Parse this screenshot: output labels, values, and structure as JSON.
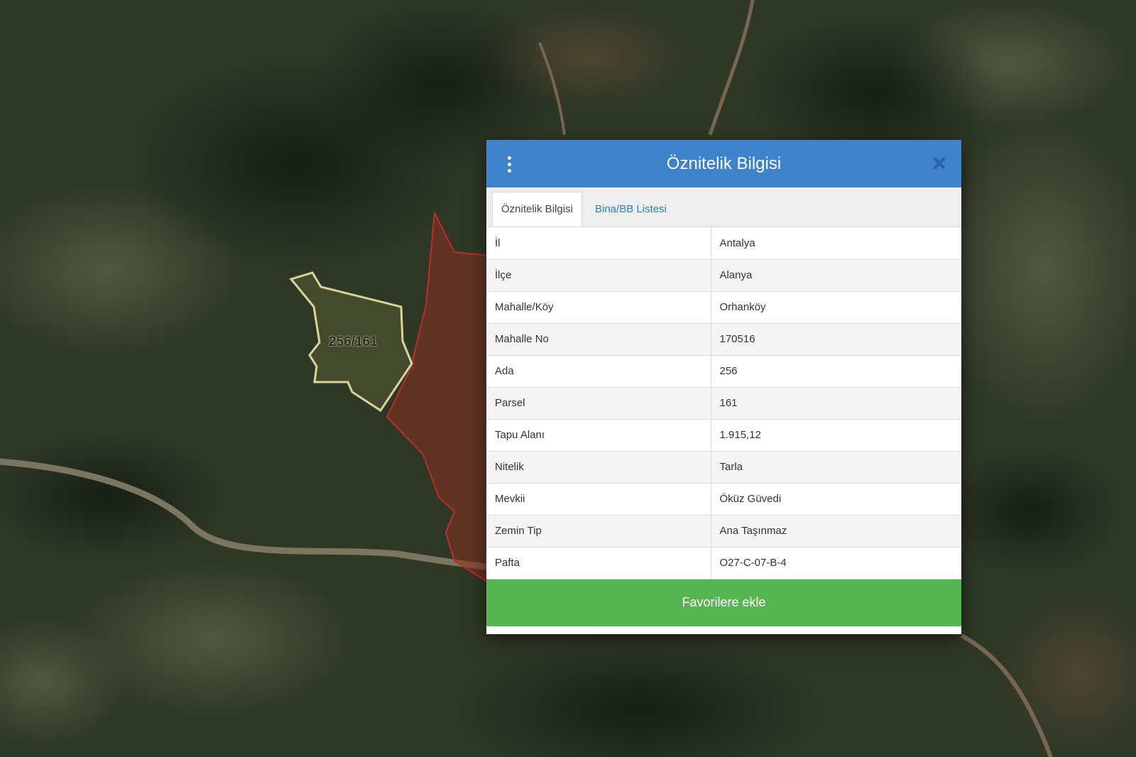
{
  "map": {
    "parcel_label": "256/161",
    "colors": {
      "satellite_base": "#2c3424",
      "parcel_outline": "#d8d59a",
      "adjacent_fill": "#8a2f1f",
      "adjacent_outline": "#c02b2b"
    }
  },
  "panel": {
    "title": "Öznitelik Bilgisi",
    "menu_icon": "kebab-menu-icon",
    "close_icon": "close-icon",
    "tabs": [
      {
        "label": "Öznitelik Bilgisi",
        "active": true
      },
      {
        "label": "Bina/BB Listesi",
        "active": false
      }
    ],
    "rows": [
      {
        "key": "İl",
        "value": "Antalya"
      },
      {
        "key": "İlçe",
        "value": "Alanya"
      },
      {
        "key": "Mahalle/Köy",
        "value": "Orhanköy"
      },
      {
        "key": "Mahalle No",
        "value": "170516"
      },
      {
        "key": "Ada",
        "value": "256"
      },
      {
        "key": "Parsel",
        "value": "161"
      },
      {
        "key": "Tapu Alanı",
        "value": "1.915,12"
      },
      {
        "key": "Nitelik",
        "value": "Tarla"
      },
      {
        "key": "Mevkii",
        "value": "Öküz Güvedi"
      },
      {
        "key": "Zemin Tip",
        "value": "Ana Taşınmaz"
      },
      {
        "key": "Pafta",
        "value": "O27-C-07-B-4"
      }
    ],
    "favorite_button": "Favorilere ekle",
    "colors": {
      "header": "#3d82cb",
      "button": "#55b652",
      "tab_link": "#2f7fc1"
    }
  }
}
